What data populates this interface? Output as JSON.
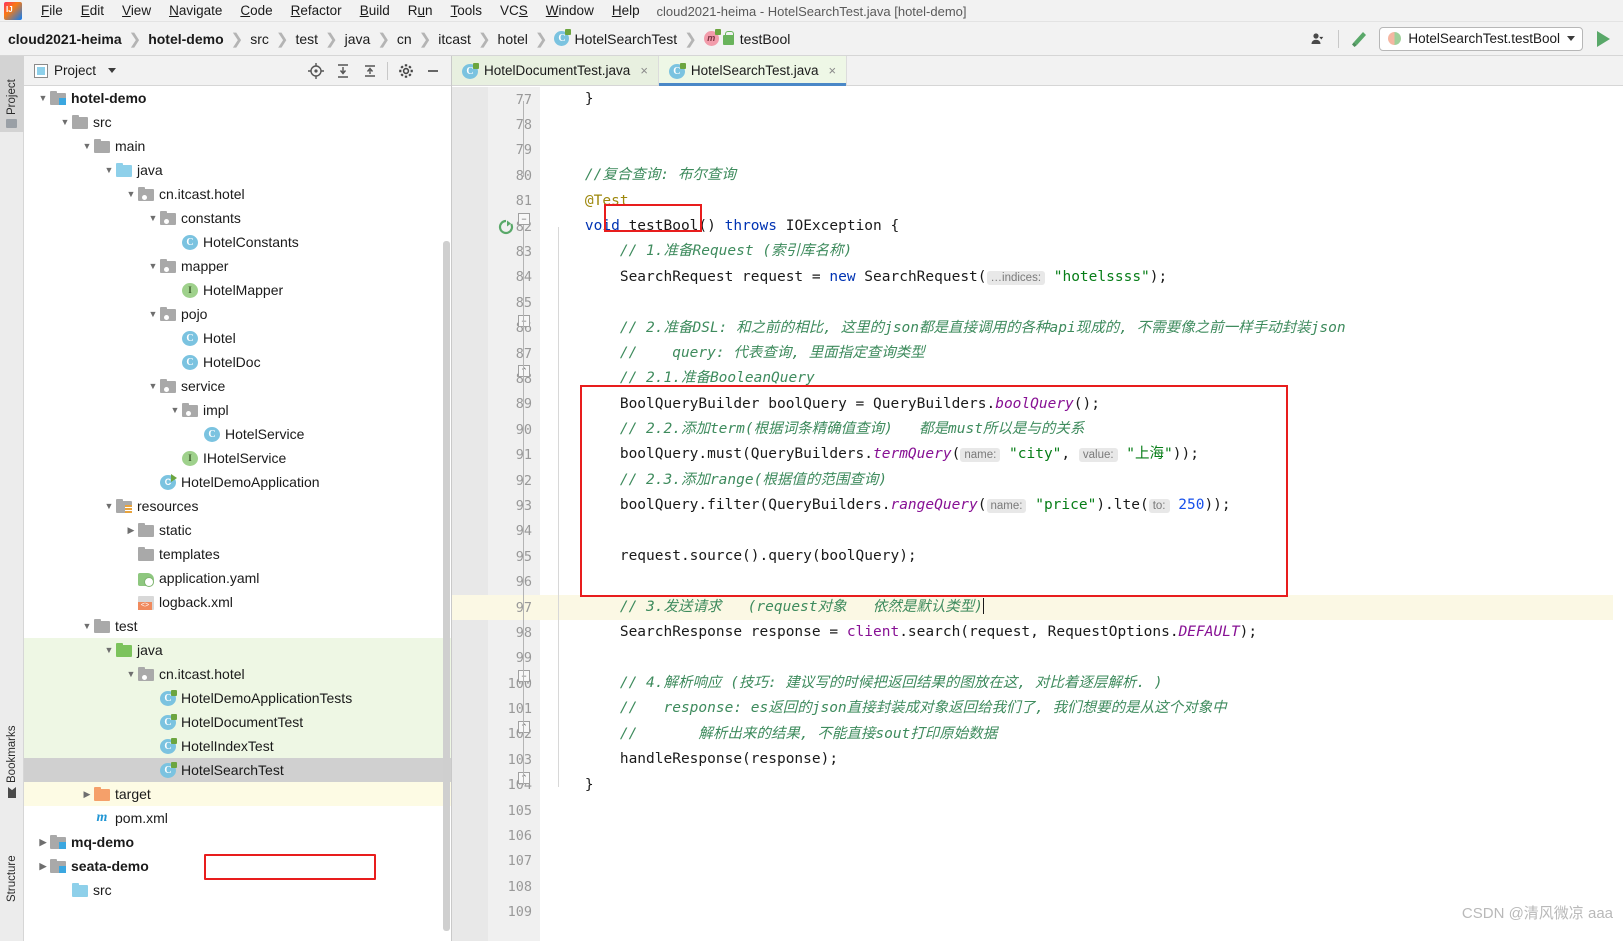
{
  "window": {
    "title": "cloud2021-heima - HotelSearchTest.java [hotel-demo]"
  },
  "menubar": {
    "items": [
      {
        "label": "File",
        "mnemonic": "F"
      },
      {
        "label": "Edit",
        "mnemonic": "E"
      },
      {
        "label": "View",
        "mnemonic": "V"
      },
      {
        "label": "Navigate",
        "mnemonic": "N"
      },
      {
        "label": "Code",
        "mnemonic": "C"
      },
      {
        "label": "Refactor",
        "mnemonic": "R"
      },
      {
        "label": "Build",
        "mnemonic": "B"
      },
      {
        "label": "Run",
        "mnemonic": "u"
      },
      {
        "label": "Tools",
        "mnemonic": "T"
      },
      {
        "label": "VCS",
        "mnemonic": "S"
      },
      {
        "label": "Window",
        "mnemonic": "W"
      },
      {
        "label": "Help",
        "mnemonic": "H"
      }
    ]
  },
  "breadcrumb": {
    "items": [
      {
        "label": "cloud2021-heima",
        "bold": true,
        "icon": null
      },
      {
        "label": "hotel-demo",
        "bold": true,
        "icon": null
      },
      {
        "label": "src",
        "bold": false,
        "icon": null
      },
      {
        "label": "test",
        "bold": false,
        "icon": null
      },
      {
        "label": "java",
        "bold": false,
        "icon": null
      },
      {
        "label": "cn",
        "bold": false,
        "icon": null
      },
      {
        "label": "itcast",
        "bold": false,
        "icon": null
      },
      {
        "label": "hotel",
        "bold": false,
        "icon": null
      },
      {
        "label": "HotelSearchTest",
        "bold": false,
        "icon": "class-icon"
      },
      {
        "label": "testBool",
        "bold": false,
        "icon": "method-icon"
      }
    ]
  },
  "toolbar": {
    "run_config_label": "HotelSearchTest.testBool",
    "user_icon": "user-icon",
    "build_icon": "hammer-icon",
    "run_icon": "run-icon"
  },
  "toolstrip": {
    "project_label": "Project",
    "bookmarks_label": "Bookmarks",
    "structure_label": "Structure"
  },
  "project_panel": {
    "title": "Project",
    "tools": [
      "locate-icon",
      "expand-all-icon",
      "collapse-all-icon",
      "gear-icon",
      "minimize-icon"
    ],
    "tree": [
      {
        "label": "hotel-demo",
        "depth": 1,
        "arrow": "down",
        "icon": "module-icon",
        "bold": true,
        "state": "normal"
      },
      {
        "label": "src",
        "depth": 2,
        "arrow": "down",
        "icon": "folder-gray-icon",
        "bold": false,
        "state": "normal"
      },
      {
        "label": "main",
        "depth": 3,
        "arrow": "down",
        "icon": "folder-gray-icon",
        "bold": false,
        "state": "normal"
      },
      {
        "label": "java",
        "depth": 4,
        "arrow": "down",
        "icon": "folder-blue-icon",
        "bold": false,
        "state": "normal"
      },
      {
        "label": "cn.itcast.hotel",
        "depth": 5,
        "arrow": "down",
        "icon": "package-icon",
        "bold": false,
        "state": "normal"
      },
      {
        "label": "constants",
        "depth": 6,
        "arrow": "down",
        "icon": "package-icon",
        "bold": false,
        "state": "normal"
      },
      {
        "label": "HotelConstants",
        "depth": 7,
        "arrow": "none",
        "icon": "class-icon",
        "bold": false,
        "state": "normal"
      },
      {
        "label": "mapper",
        "depth": 6,
        "arrow": "down",
        "icon": "package-icon",
        "bold": false,
        "state": "normal"
      },
      {
        "label": "HotelMapper",
        "depth": 7,
        "arrow": "none",
        "icon": "interface-icon",
        "bold": false,
        "state": "normal"
      },
      {
        "label": "pojo",
        "depth": 6,
        "arrow": "down",
        "icon": "package-icon",
        "bold": false,
        "state": "normal"
      },
      {
        "label": "Hotel",
        "depth": 7,
        "arrow": "none",
        "icon": "class-icon",
        "bold": false,
        "state": "normal"
      },
      {
        "label": "HotelDoc",
        "depth": 7,
        "arrow": "none",
        "icon": "class-icon",
        "bold": false,
        "state": "normal"
      },
      {
        "label": "service",
        "depth": 6,
        "arrow": "down",
        "icon": "package-icon",
        "bold": false,
        "state": "normal"
      },
      {
        "label": "impl",
        "depth": 7,
        "arrow": "down",
        "icon": "package-icon",
        "bold": false,
        "state": "normal"
      },
      {
        "label": "HotelService",
        "depth": 8,
        "arrow": "none",
        "icon": "class-icon",
        "bold": false,
        "state": "normal"
      },
      {
        "label": "IHotelService",
        "depth": 7,
        "arrow": "none",
        "icon": "interface-icon",
        "bold": false,
        "state": "normal"
      },
      {
        "label": "HotelDemoApplication",
        "depth": 6,
        "arrow": "none",
        "icon": "spring-class-icon",
        "bold": false,
        "state": "normal"
      },
      {
        "label": "resources",
        "depth": 4,
        "arrow": "down",
        "icon": "resources-icon",
        "bold": false,
        "state": "normal"
      },
      {
        "label": "static",
        "depth": 5,
        "arrow": "right",
        "icon": "folder-gray-icon",
        "bold": false,
        "state": "normal"
      },
      {
        "label": "templates",
        "depth": 5,
        "arrow": "none",
        "icon": "folder-gray-icon",
        "bold": false,
        "state": "normal"
      },
      {
        "label": "application.yaml",
        "depth": 5,
        "arrow": "none",
        "icon": "yaml-icon",
        "bold": false,
        "state": "normal"
      },
      {
        "label": "logback.xml",
        "depth": 5,
        "arrow": "none",
        "icon": "xml-icon",
        "bold": false,
        "state": "normal"
      },
      {
        "label": "test",
        "depth": 3,
        "arrow": "down",
        "icon": "folder-gray-icon",
        "bold": false,
        "state": "normal"
      },
      {
        "label": "java",
        "depth": 4,
        "arrow": "down",
        "icon": "folder-green-icon",
        "bold": false,
        "state": "green"
      },
      {
        "label": "cn.itcast.hotel",
        "depth": 5,
        "arrow": "down",
        "icon": "package-icon",
        "bold": false,
        "state": "green"
      },
      {
        "label": "HotelDemoApplicationTests",
        "depth": 6,
        "arrow": "none",
        "icon": "test-class-icon",
        "bold": false,
        "state": "green"
      },
      {
        "label": "HotelDocumentTest",
        "depth": 6,
        "arrow": "none",
        "icon": "test-class-icon",
        "bold": false,
        "state": "green"
      },
      {
        "label": "HotelIndexTest",
        "depth": 6,
        "arrow": "none",
        "icon": "test-class-icon",
        "bold": false,
        "state": "green"
      },
      {
        "label": "HotelSearchTest",
        "depth": 6,
        "arrow": "none",
        "icon": "test-class-icon",
        "bold": false,
        "state": "selected"
      },
      {
        "label": "target",
        "depth": 3,
        "arrow": "right",
        "icon": "folder-orange-icon",
        "bold": false,
        "state": "yellow"
      },
      {
        "label": "pom.xml",
        "depth": 3,
        "arrow": "none",
        "icon": "maven-icon",
        "bold": false,
        "state": "normal"
      },
      {
        "label": "mq-demo",
        "depth": 1,
        "arrow": "right",
        "icon": "module-icon",
        "bold": true,
        "state": "normal"
      },
      {
        "label": "seata-demo",
        "depth": 1,
        "arrow": "right",
        "icon": "module-icon",
        "bold": true,
        "state": "normal"
      },
      {
        "label": "src",
        "depth": 2,
        "arrow": "none",
        "icon": "folder-blue-icon",
        "bold": false,
        "state": "normal"
      }
    ]
  },
  "editor": {
    "tabs": [
      {
        "label": "HotelDocumentTest.java",
        "active": false,
        "closable": true
      },
      {
        "label": "HotelSearchTest.java",
        "active": true,
        "closable": true
      }
    ],
    "line_numbers": [
      77,
      78,
      79,
      80,
      81,
      82,
      83,
      84,
      85,
      86,
      87,
      88,
      89,
      90,
      91,
      92,
      93,
      94,
      95,
      96,
      97,
      98,
      99,
      100,
      101,
      102,
      103,
      104,
      105,
      106,
      107,
      108,
      109
    ],
    "highlight_line": 97,
    "run_marker_line": 82,
    "code": [
      {
        "n": 77,
        "tokens": [
          {
            "t": "    }",
            "c": "plain"
          }
        ]
      },
      {
        "n": 78,
        "tokens": []
      },
      {
        "n": 79,
        "tokens": []
      },
      {
        "n": 80,
        "tokens": [
          {
            "t": "    //复合查询: 布尔查询",
            "c": "cmt"
          }
        ]
      },
      {
        "n": 81,
        "tokens": [
          {
            "t": "    @Test",
            "c": "ann"
          }
        ]
      },
      {
        "n": 82,
        "tokens": [
          {
            "t": "    ",
            "c": "plain"
          },
          {
            "t": "void",
            "c": "kw"
          },
          {
            "t": " testBool() ",
            "c": "plain"
          },
          {
            "t": "throws",
            "c": "kw"
          },
          {
            "t": " IOException {",
            "c": "plain"
          }
        ]
      },
      {
        "n": 83,
        "tokens": [
          {
            "t": "        // 1.准备Request (索引库名称)",
            "c": "cmt"
          }
        ]
      },
      {
        "n": 84,
        "tokens": [
          {
            "t": "        SearchRequest request = ",
            "c": "plain"
          },
          {
            "t": "new",
            "c": "kw"
          },
          {
            "t": " SearchRequest(",
            "c": "plain"
          },
          {
            "t": "…indices:",
            "c": "hint"
          },
          {
            "t": " \"hotelssss\"",
            "c": "str"
          },
          {
            "t": ");",
            "c": "plain"
          }
        ]
      },
      {
        "n": 85,
        "tokens": []
      },
      {
        "n": 86,
        "tokens": [
          {
            "t": "        // 2.准备DSL: 和之前的相比, 这里的json都是直接调用的各种api现成的, 不需要像之前一样手动封装json",
            "c": "cmt"
          }
        ]
      },
      {
        "n": 87,
        "tokens": [
          {
            "t": "        //    query: 代表查询, 里面指定查询类型",
            "c": "cmt"
          }
        ]
      },
      {
        "n": 88,
        "tokens": [
          {
            "t": "        // 2.1.准备BooleanQuery",
            "c": "cmt"
          }
        ]
      },
      {
        "n": 89,
        "tokens": [
          {
            "t": "        BoolQueryBuilder boolQuery = QueryBuilders.",
            "c": "plain"
          },
          {
            "t": "boolQuery",
            "c": "stat"
          },
          {
            "t": "();",
            "c": "plain"
          }
        ]
      },
      {
        "n": 90,
        "tokens": [
          {
            "t": "        // 2.2.添加term(根据词条精确值查询)   都是must所以是与的关系",
            "c": "cmt"
          }
        ]
      },
      {
        "n": 91,
        "tokens": [
          {
            "t": "        boolQuery.must(QueryBuilders.",
            "c": "plain"
          },
          {
            "t": "termQuery",
            "c": "stat"
          },
          {
            "t": "(",
            "c": "plain"
          },
          {
            "t": "name:",
            "c": "hint"
          },
          {
            "t": " \"city\"",
            "c": "str"
          },
          {
            "t": ", ",
            "c": "plain"
          },
          {
            "t": "value:",
            "c": "hint"
          },
          {
            "t": " \"上海\"",
            "c": "str"
          },
          {
            "t": "));",
            "c": "plain"
          }
        ]
      },
      {
        "n": 92,
        "tokens": [
          {
            "t": "        // 2.3.添加range(根据值的范围查询)",
            "c": "cmt"
          }
        ]
      },
      {
        "n": 93,
        "tokens": [
          {
            "t": "        boolQuery.filter(QueryBuilders.",
            "c": "plain"
          },
          {
            "t": "rangeQuery",
            "c": "stat"
          },
          {
            "t": "(",
            "c": "plain"
          },
          {
            "t": "name:",
            "c": "hint"
          },
          {
            "t": " \"price\"",
            "c": "str"
          },
          {
            "t": ").lte(",
            "c": "plain"
          },
          {
            "t": "to:",
            "c": "hint"
          },
          {
            "t": " 250",
            "c": "num"
          },
          {
            "t": "));",
            "c": "plain"
          }
        ]
      },
      {
        "n": 94,
        "tokens": []
      },
      {
        "n": 95,
        "tokens": [
          {
            "t": "        request.source().query(boolQuery);",
            "c": "plain"
          }
        ]
      },
      {
        "n": 96,
        "tokens": []
      },
      {
        "n": 97,
        "tokens": [
          {
            "t": "        // 3.发送请求   (request对象   依然是默认类型)",
            "c": "cmt"
          }
        ]
      },
      {
        "n": 98,
        "tokens": [
          {
            "t": "        SearchResponse response = ",
            "c": "plain"
          },
          {
            "t": "client",
            "c": "field"
          },
          {
            "t": ".search(request, RequestOptions.",
            "c": "plain"
          },
          {
            "t": "DEFAULT",
            "c": "stat"
          },
          {
            "t": ");",
            "c": "plain"
          }
        ]
      },
      {
        "n": 99,
        "tokens": []
      },
      {
        "n": 100,
        "tokens": [
          {
            "t": "        // 4.解析响应 (技巧: 建议写的时候把返回结果的图放在这, 对比着逐层解析. )",
            "c": "cmt"
          }
        ]
      },
      {
        "n": 101,
        "tokens": [
          {
            "t": "        //   response: es返回的json直接封装成对象返回给我们了, 我们想要的是从这个对象中",
            "c": "cmt"
          }
        ]
      },
      {
        "n": 102,
        "tokens": [
          {
            "t": "        //       解析出来的结果, 不能直接sout打印原始数据",
            "c": "cmt"
          }
        ]
      },
      {
        "n": 103,
        "tokens": [
          {
            "t": "        handleResponse(response);",
            "c": "plain"
          }
        ]
      },
      {
        "n": 104,
        "tokens": [
          {
            "t": "    }",
            "c": "plain"
          }
        ]
      },
      {
        "n": 105,
        "tokens": []
      },
      {
        "n": 106,
        "tokens": []
      },
      {
        "n": 107,
        "tokens": []
      },
      {
        "n": 108,
        "tokens": []
      },
      {
        "n": 109,
        "tokens": []
      }
    ]
  },
  "annotations": {
    "red_boxes": [
      "testBool-method-name",
      "code-block-2-1-to-2-3",
      "HotelSearchTest-tree-item"
    ]
  },
  "watermark": {
    "text": "CSDN @清风微凉 aaa"
  },
  "colors": {
    "accent_blue": "#4a88c7",
    "run_green": "#59a869",
    "annotation_red": "#e81d1d",
    "comment_green": "#3e8b5d",
    "string_green": "#067d17",
    "keyword_blue": "#0033b3",
    "highlight_line": "#fbf8e4",
    "tree_green": "#eef7e4"
  }
}
